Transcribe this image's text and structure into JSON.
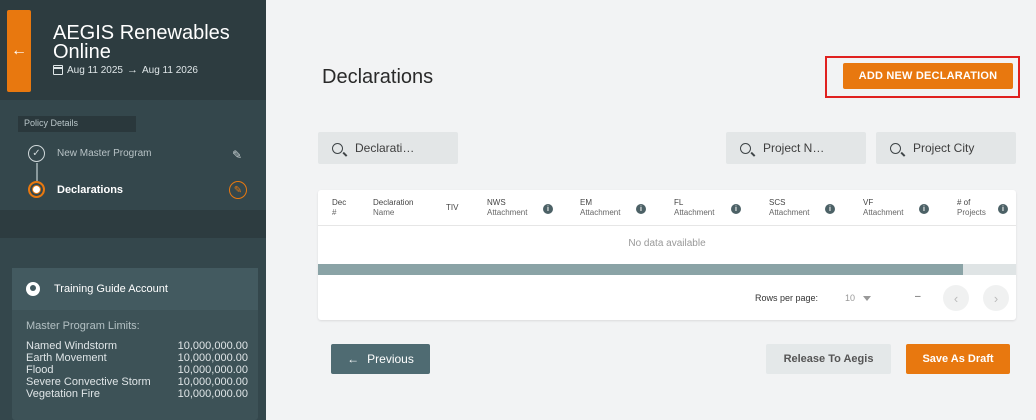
{
  "sidebar": {
    "title": "AEGIS Renewables Online",
    "date_start": "Aug 11 2025",
    "date_arrow": "→",
    "date_end": "Aug 11 2026",
    "back_icon": "arrow-left-icon",
    "section_label": "Policy Details",
    "steps": [
      {
        "label": "New Master Program",
        "state": "completed"
      },
      {
        "label": "Declarations",
        "state": "active"
      }
    ],
    "account": {
      "name": "Training Guide Account",
      "limits_title": "Master Program Limits:",
      "limits": [
        {
          "label": "Named Windstorm",
          "value": "10,000,000.00"
        },
        {
          "label": "Earth Movement",
          "value": "10,000,000.00"
        },
        {
          "label": "Flood",
          "value": "10,000,000.00"
        },
        {
          "label": "Severe Convective Storm",
          "value": "10,000,000.00"
        },
        {
          "label": "Vegetation Fire",
          "value": "10,000,000.00"
        }
      ]
    }
  },
  "main": {
    "title": "Declarations",
    "add_button": "ADD NEW DECLARATION",
    "search": {
      "declaration_placeholder": "Declarati…",
      "project_name_placeholder": "Project N…",
      "project_city_placeholder": "Project City"
    },
    "table": {
      "columns": [
        {
          "line1": "Dec",
          "line2": "#"
        },
        {
          "line1": "Declaration",
          "line2": "Name"
        },
        {
          "line1": "TIV",
          "line2": ""
        },
        {
          "line1": "NWS",
          "line2": "Attachment"
        },
        {
          "line1": "EM",
          "line2": "Attachment"
        },
        {
          "line1": "FL",
          "line2": "Attachment"
        },
        {
          "line1": "SCS",
          "line2": "Attachment"
        },
        {
          "line1": "VF",
          "line2": "Attachment"
        },
        {
          "line1": "# of",
          "line2": "Projects"
        }
      ],
      "empty_text": "No data available",
      "rows_per_page_label": "Rows per page:",
      "rows_per_page_value": "10",
      "page_range": "–"
    },
    "buttons": {
      "previous": "Previous",
      "release": "Release To Aegis",
      "save_draft": "Save As Draft"
    }
  },
  "colors": {
    "accent": "#e8780f",
    "sidebar": "#34474c",
    "highlight_frame": "#e0201f"
  }
}
